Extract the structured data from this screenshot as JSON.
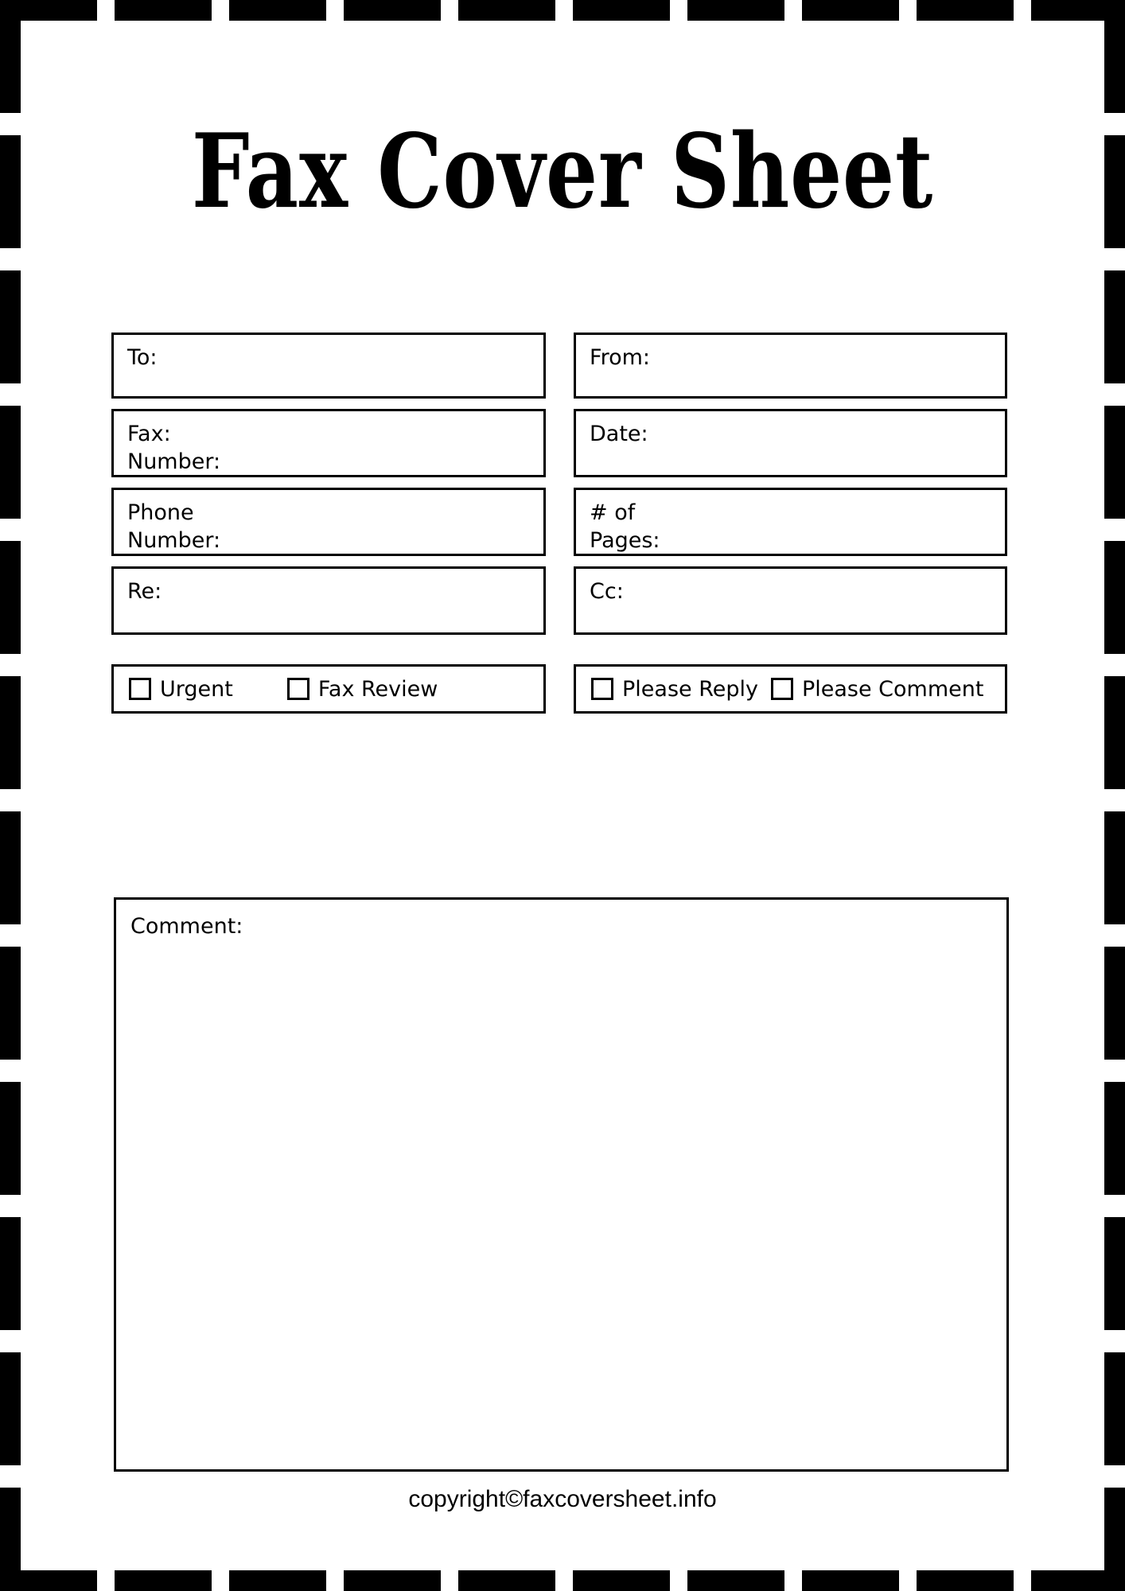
{
  "document": {
    "title": "Fax Cover Sheet",
    "footer": "copyright©faxcoversheet.info"
  },
  "fields": {
    "to": {
      "label": "To:"
    },
    "from": {
      "label": "From:"
    },
    "fax_number": {
      "label_line1": "Fax:",
      "label_line2": "Number:"
    },
    "date": {
      "label": "Date:"
    },
    "phone_number": {
      "label_line1": "Phone",
      "label_line2": "Number:"
    },
    "pages": {
      "label_line1": "# of",
      "label_line2": "Pages:"
    },
    "re": {
      "label": "Re:"
    },
    "cc": {
      "label": "Cc:"
    },
    "comment": {
      "label": "Comment:"
    }
  },
  "checkboxes": {
    "left_group": [
      {
        "label": "Urgent",
        "checked": false
      },
      {
        "label": "Fax Review",
        "checked": false
      }
    ],
    "right_group": [
      {
        "label": "Please Reply",
        "checked": false
      },
      {
        "label": "Please Comment",
        "checked": false
      }
    ]
  },
  "style": {
    "ink": "#000000",
    "paper": "#ffffff"
  }
}
